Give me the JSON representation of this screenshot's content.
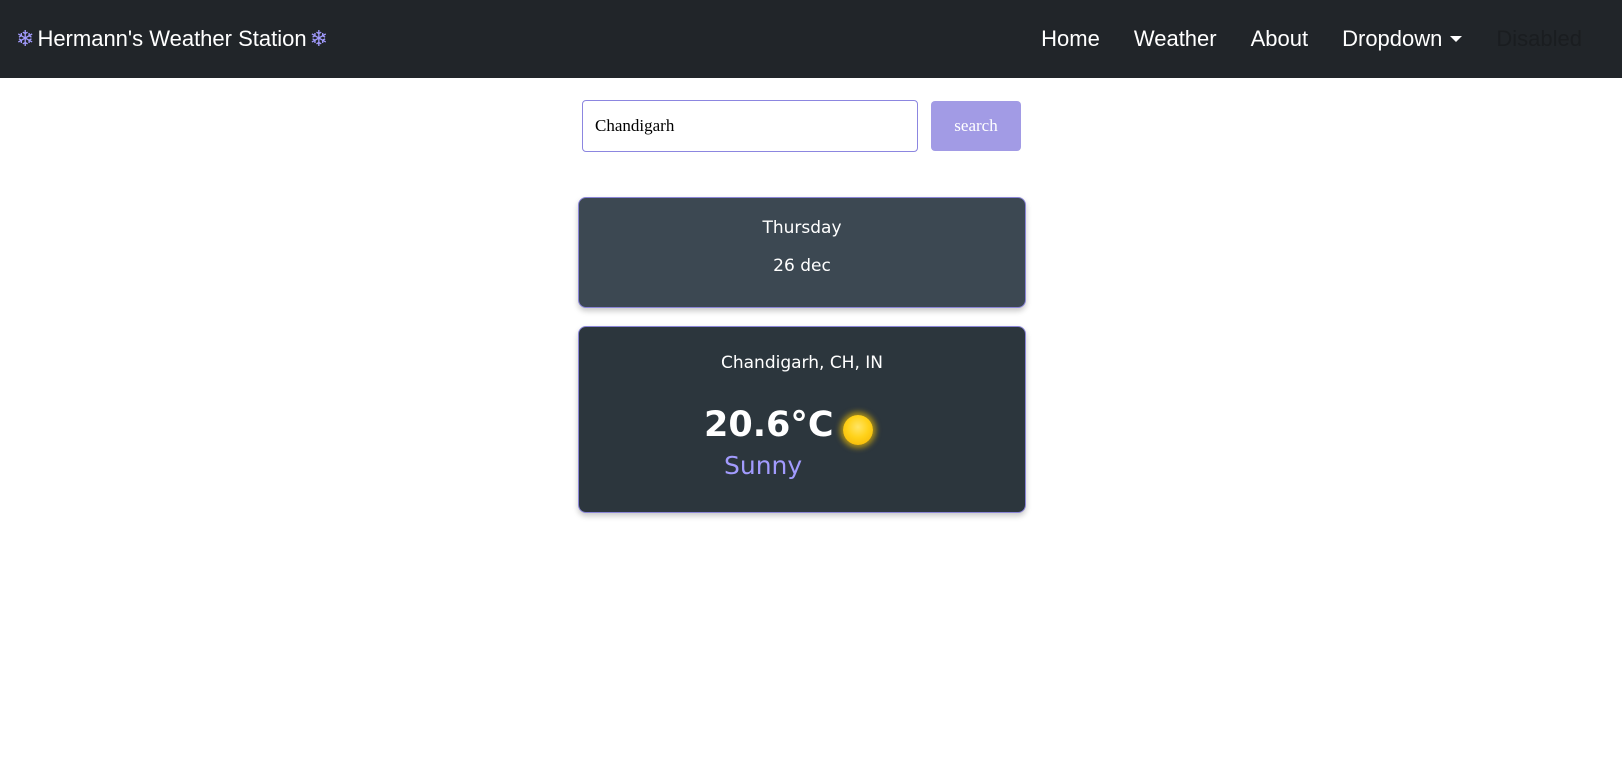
{
  "navbar": {
    "brand_icon": "snowflake-icon",
    "brand_icon_glyph": "❄",
    "brand_title": "Hermann's Weather Station",
    "links": [
      {
        "label": "Home"
      },
      {
        "label": "Weather"
      },
      {
        "label": "About"
      },
      {
        "label": "Dropdown"
      },
      {
        "label": "Disabled"
      }
    ]
  },
  "search": {
    "value": "Chandigarh",
    "button_label": "search"
  },
  "date_card": {
    "day": "Thursday",
    "date": "26 dec"
  },
  "weather_card": {
    "location": "Chandigarh, CH, IN",
    "temperature": "20.6°C",
    "condition": "Sunny",
    "icon": "sun-icon"
  },
  "colors": {
    "navbar_bg": "#212529",
    "accent": "#a29bfe",
    "date_card_bg": "#3c4852",
    "weather_card_bg": "#2c363d",
    "sun": "#ffd21a"
  }
}
